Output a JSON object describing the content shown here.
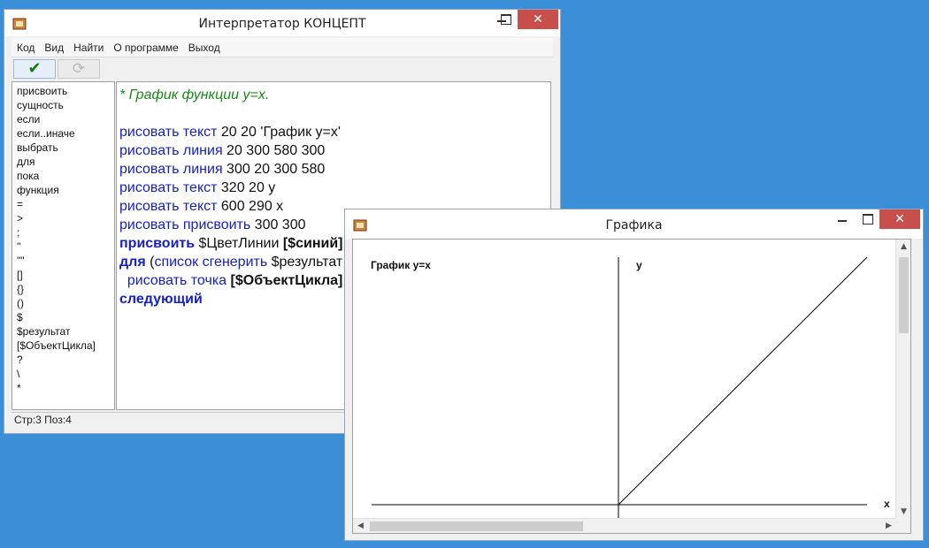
{
  "main_window": {
    "title": "Интерпретатор КОНЦЕПТ",
    "close_glyph": "✕",
    "menu": [
      "Код",
      "Вид",
      "Найти",
      "О программе",
      "Выход"
    ],
    "toolbar": {
      "run_glyph": "✔",
      "refresh_glyph": "⟳"
    },
    "keywords": [
      "присвоить",
      "сущность",
      "если",
      "если..иначе",
      "выбрать",
      "для",
      "пока",
      "функция",
      "=",
      ">",
      ";",
      "''",
      "\"\"",
      "[]",
      "{}",
      "()",
      "$",
      "$результат",
      "[$ОбъектЦикла]",
      "?",
      "\\",
      "*"
    ],
    "code_lines": [
      [
        {
          "c": "cm",
          "t": "* График функции y=x."
        }
      ],
      [],
      [
        {
          "c": "kb",
          "t": "рисовать текст"
        },
        {
          "c": "tx",
          "t": " 20 20 'График y=x'"
        }
      ],
      [
        {
          "c": "kb",
          "t": "рисовать линия"
        },
        {
          "c": "tx",
          "t": " 20 300 580 300"
        }
      ],
      [
        {
          "c": "kb",
          "t": "рисовать линия"
        },
        {
          "c": "tx",
          "t": " 300 20 300 580"
        }
      ],
      [
        {
          "c": "kb",
          "t": "рисовать текст"
        },
        {
          "c": "tx",
          "t": " 320 20 y"
        }
      ],
      [
        {
          "c": "kb",
          "t": "рисовать текст"
        },
        {
          "c": "tx",
          "t": " 600 290 x"
        }
      ],
      [
        {
          "c": "kb",
          "t": "рисовать присвоить"
        },
        {
          "c": "tx",
          "t": " 300 300"
        }
      ],
      [
        {
          "c": "kbb",
          "t": "присвоить"
        },
        {
          "c": "tx",
          "t": " $ЦветЛинии "
        },
        {
          "c": "txb",
          "t": "[$синий]"
        }
      ],
      [
        {
          "c": "kbb",
          "t": "для"
        },
        {
          "c": "tx",
          "t": " ("
        },
        {
          "c": "kb",
          "t": "список сгенерить"
        },
        {
          "c": "tx",
          "t": " $результат"
        }
      ],
      [
        {
          "c": "tx",
          "t": "  "
        },
        {
          "c": "kb",
          "t": "рисовать точка"
        },
        {
          "c": "tx",
          "t": " "
        },
        {
          "c": "txb",
          "t": "[$ОбъектЦикла]"
        }
      ],
      [
        {
          "c": "kbb",
          "t": "следующий"
        }
      ]
    ],
    "status": "Стр:3 Поз:4"
  },
  "graph_window": {
    "title": "Графика",
    "close_glyph": "✕",
    "canvas_text": {
      "title": "График y=x",
      "y_label": "y",
      "x_label": "x"
    },
    "scroll_arrows": {
      "up": "▲",
      "down": "▼",
      "left": "◀",
      "right": "▶"
    }
  }
}
